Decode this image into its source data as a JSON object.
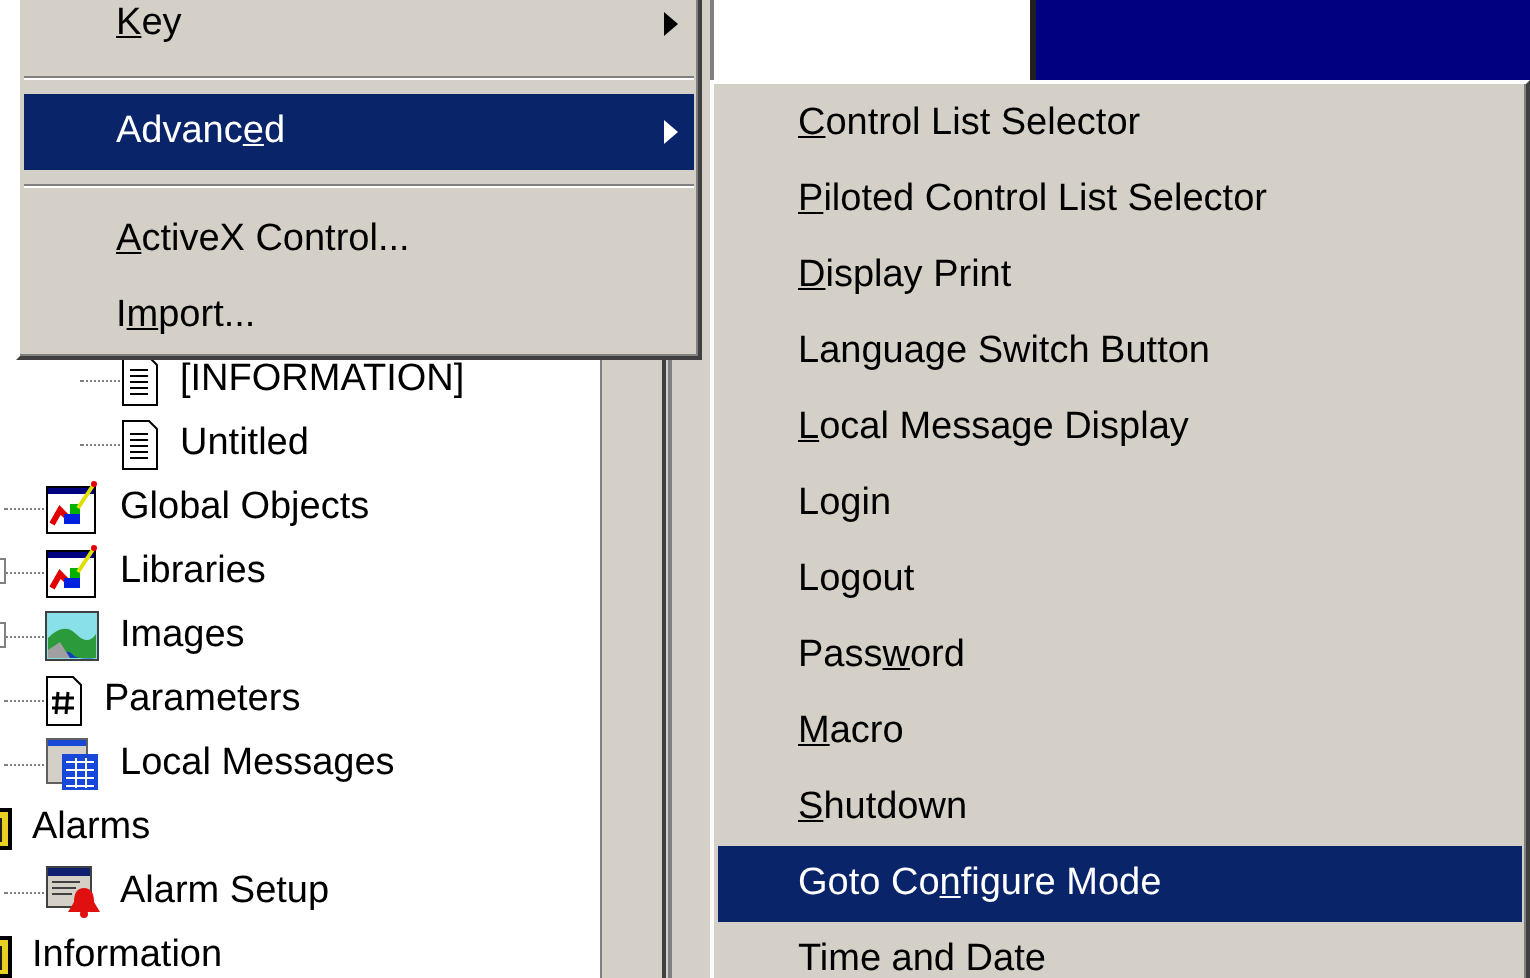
{
  "tree": [
    {
      "children": [
        {
          "children": [
            {
              "label": "[INFORMATION]",
              "kind": "document"
            },
            {
              "label": "Untitled",
              "kind": "document"
            }
          ]
        },
        {
          "label": "Global Objects",
          "kind": "objects"
        },
        {
          "label": "Libraries",
          "kind": "objects",
          "has_expander": true
        },
        {
          "label": "Images",
          "kind": "image",
          "has_expander": true
        },
        {
          "label": "Parameters",
          "kind": "parameters"
        },
        {
          "label": "Local Messages",
          "kind": "messages"
        }
      ]
    },
    {
      "label": "Alarms",
      "kind": "folder",
      "children": [
        {
          "label": "Alarm Setup",
          "kind": "alarm"
        }
      ]
    },
    {
      "label": "Information",
      "kind": "folder"
    }
  ],
  "context_menu": {
    "items": [
      {
        "kind": "item",
        "access_key": "K",
        "text_after": "ey",
        "has_submenu": true,
        "selected": false
      },
      {
        "kind": "separator"
      },
      {
        "kind": "item",
        "text_before": "Advanc",
        "access_key": "e",
        "text_after": "d",
        "has_submenu": true,
        "selected": true
      },
      {
        "kind": "separator"
      },
      {
        "kind": "item",
        "access_key": "A",
        "text_after": "ctiveX Control...",
        "selected": false
      },
      {
        "kind": "item",
        "text_before": "I",
        "access_key": "m",
        "text_after": "port...",
        "selected": false
      }
    ]
  },
  "submenu": {
    "items": [
      {
        "kind": "item",
        "access_key": "C",
        "text_after": "ontrol List Selector",
        "selected": false
      },
      {
        "kind": "item",
        "access_key": "P",
        "text_after": "iloted Control List Selector",
        "selected": false
      },
      {
        "kind": "item",
        "access_key": "D",
        "text_after": "isplay Print",
        "selected": false
      },
      {
        "kind": "item",
        "text_before": "Language Switch Button",
        "selected": false
      },
      {
        "kind": "item",
        "access_key": "L",
        "text_after": "ocal Message Display",
        "selected": false
      },
      {
        "kind": "item",
        "text_before": "Lo",
        "access_key": "g",
        "text_after": "in",
        "selected": false
      },
      {
        "kind": "item",
        "text_before": "Lo",
        "access_key": "g",
        "text_after": "out",
        "selected": false
      },
      {
        "kind": "item",
        "text_before": "Pass",
        "access_key": "w",
        "text_after": "ord",
        "selected": false
      },
      {
        "kind": "item",
        "access_key": "M",
        "text_after": "acro",
        "selected": false
      },
      {
        "kind": "item",
        "access_key": "S",
        "text_after": "hutdown",
        "selected": false
      },
      {
        "kind": "item",
        "text_before": "Goto Co",
        "access_key": "n",
        "text_after": "figure Mode",
        "selected": true
      },
      {
        "kind": "item",
        "text_before": "Time and Date",
        "selected": false
      }
    ]
  }
}
